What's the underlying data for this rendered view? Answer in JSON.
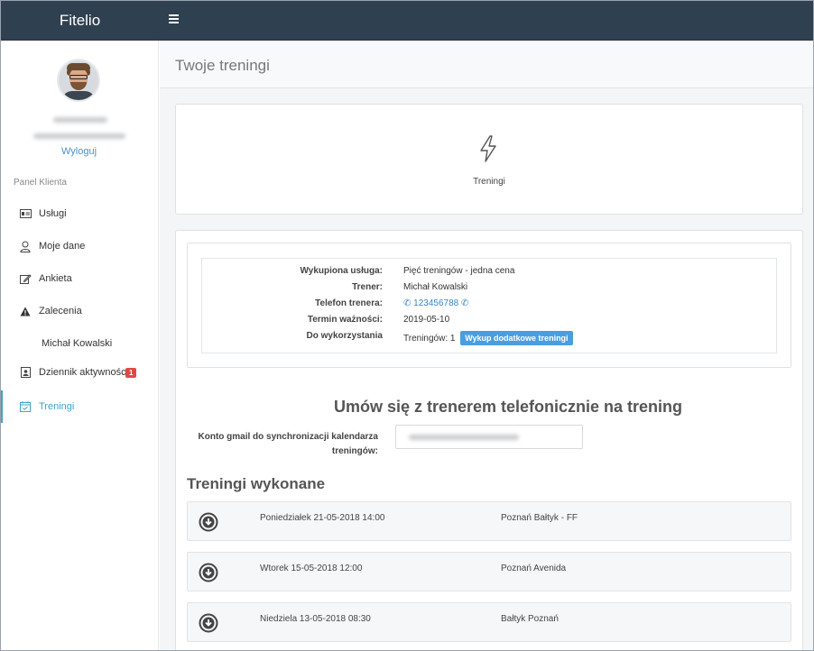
{
  "app": {
    "brand": "Fitelio"
  },
  "user": {
    "logout_label": "Wyloguj"
  },
  "sidebar": {
    "section_label": "Panel Klienta",
    "items": [
      {
        "label": "Usługi",
        "icon": "id-card-icon"
      },
      {
        "label": "Moje dane",
        "icon": "user-icon"
      },
      {
        "label": "Ankieta",
        "icon": "edit-icon"
      },
      {
        "label": "Zalecenia",
        "icon": "warning-icon"
      },
      {
        "label": "Dziennik aktywności",
        "icon": "journal-icon",
        "badge": "1"
      },
      {
        "label": "Treningi",
        "icon": "calendar-check-icon",
        "active": true
      }
    ],
    "sub_item": "Michał Kowalski"
  },
  "page": {
    "title": "Twoje treningi"
  },
  "tile": {
    "label": "Treningi",
    "icon": "bolt-icon"
  },
  "service": {
    "rows": [
      {
        "key": "Wykupiona usługa:",
        "value": "Pięć treningów - jedna cena"
      },
      {
        "key": "Trener:",
        "value": "Michał Kowalski"
      },
      {
        "key": "Telefon trenera:",
        "value": "123456788"
      },
      {
        "key": "Termin ważności:",
        "value": "2019-05-10"
      },
      {
        "key": "Do wykorzystania",
        "value": "Treningów: 1"
      }
    ],
    "buy_button": "Wykup dodatkowe treningi"
  },
  "call_heading": "Umów się z trenerem telefonicznie na trening",
  "gmail": {
    "label": "Konto gmail do synchronizacji kalendarza treningów:"
  },
  "done": {
    "heading": "Treningi wykonane",
    "rows": [
      {
        "datetime": "Poniedziałek 21-05-2018 14:00",
        "place": "Poznań Bałtyk - FF"
      },
      {
        "datetime": "Wtorek 15-05-2018 12:00",
        "place": "Poznań Avenida"
      },
      {
        "datetime": "Niedziela 13-05-2018 08:30",
        "place": "Bałtyk Poznań"
      }
    ]
  },
  "colors": {
    "topbar": "#2f4050",
    "accent": "#3aa5c9",
    "button": "#4a9ee0",
    "badge": "#e04848"
  }
}
